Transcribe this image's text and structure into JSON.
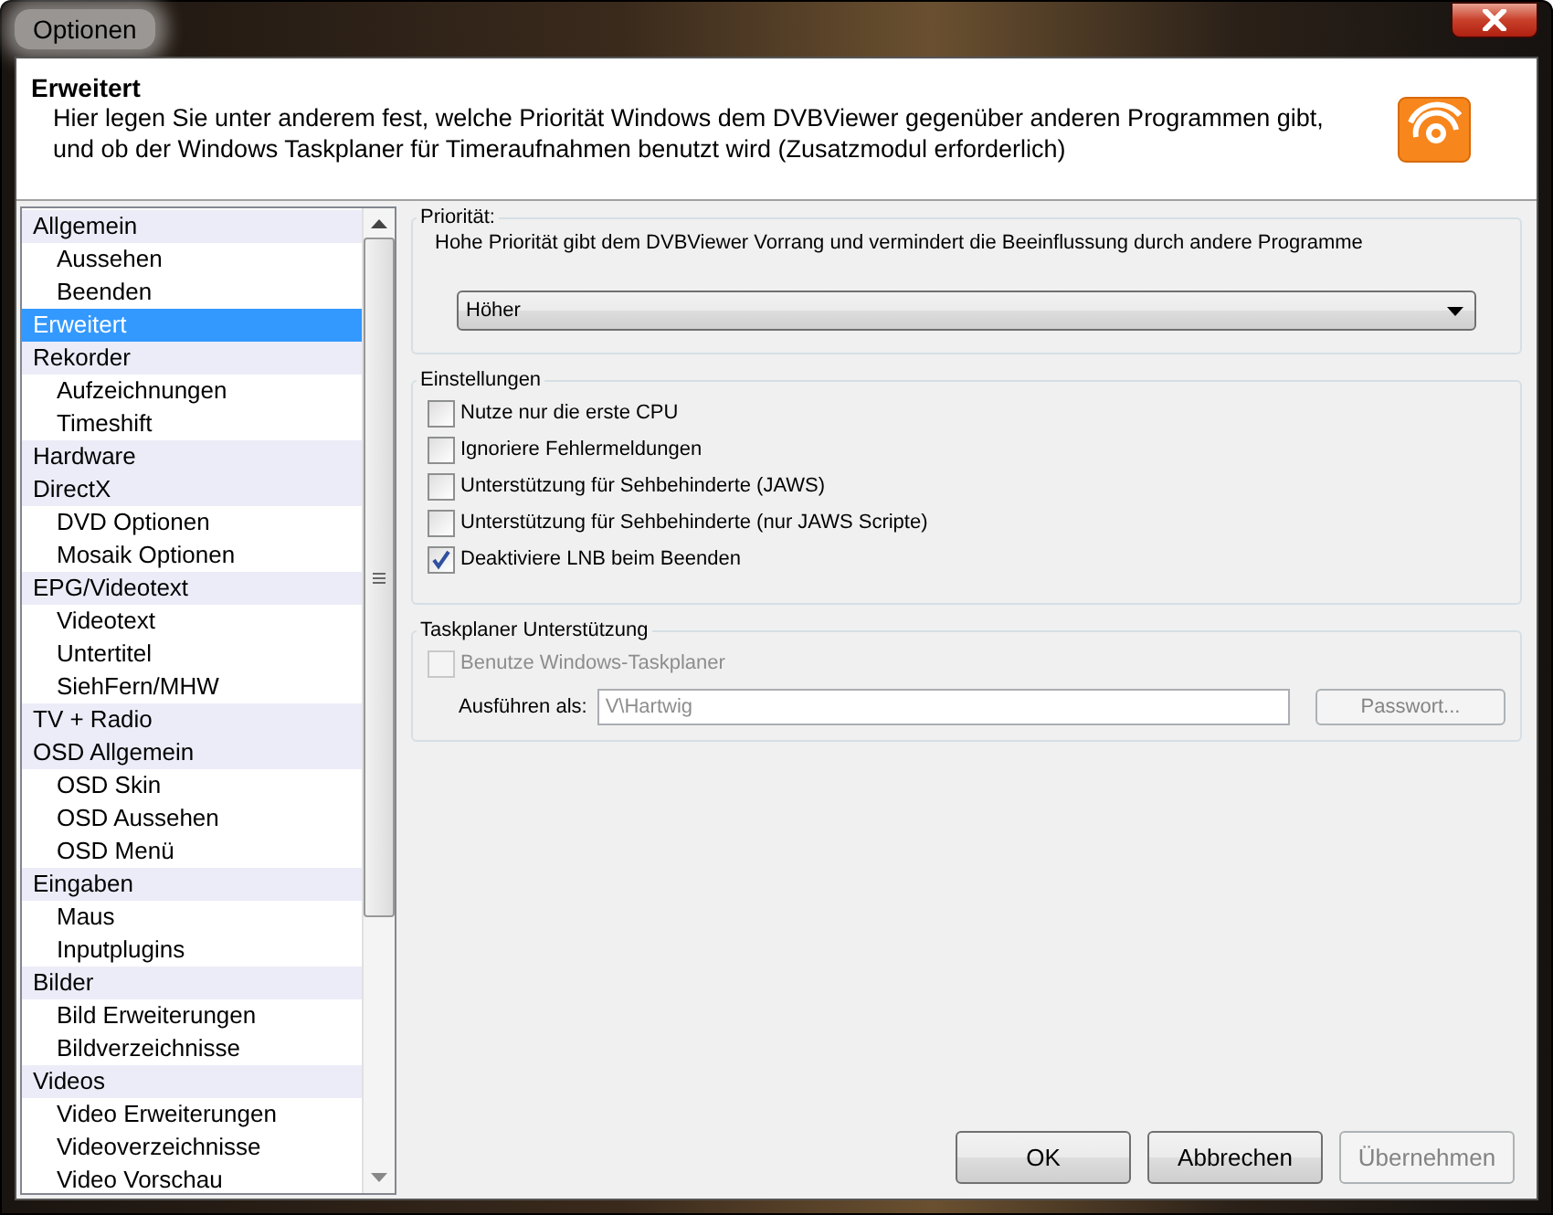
{
  "window": {
    "title": "Optionen"
  },
  "header": {
    "title": "Erweitert",
    "description": "Hier legen Sie unter anderem fest, welche Priorität Windows dem DVBViewer gegenüber anderen Programmen gibt, und ob der Windows Taskplaner für Timeraufnahmen benutzt wird (Zusatzmodul erforderlich)"
  },
  "sidebar": {
    "items": [
      {
        "label": "Allgemein",
        "selected": false,
        "children": [
          {
            "label": "Aussehen",
            "selected": false
          },
          {
            "label": "Beenden",
            "selected": false
          }
        ]
      },
      {
        "label": "Erweitert",
        "selected": true
      },
      {
        "label": "Rekorder",
        "selected": false,
        "children": [
          {
            "label": "Aufzeichnungen",
            "selected": false
          },
          {
            "label": "Timeshift",
            "selected": false
          }
        ]
      },
      {
        "label": "Hardware",
        "selected": false
      },
      {
        "label": "DirectX",
        "selected": false,
        "children": [
          {
            "label": "DVD Optionen",
            "selected": false
          },
          {
            "label": "Mosaik Optionen",
            "selected": false
          }
        ]
      },
      {
        "label": "EPG/Videotext",
        "selected": false,
        "children": [
          {
            "label": "Videotext",
            "selected": false
          },
          {
            "label": "Untertitel",
            "selected": false
          },
          {
            "label": "SiehFern/MHW",
            "selected": false
          }
        ]
      },
      {
        "label": "TV + Radio",
        "selected": false
      },
      {
        "label": "OSD Allgemein",
        "selected": false,
        "children": [
          {
            "label": "OSD Skin",
            "selected": false
          },
          {
            "label": "OSD Aussehen",
            "selected": false
          },
          {
            "label": "OSD Menü",
            "selected": false
          }
        ]
      },
      {
        "label": "Eingaben",
        "selected": false,
        "children": [
          {
            "label": "Maus",
            "selected": false
          },
          {
            "label": "Inputplugins",
            "selected": false
          }
        ]
      },
      {
        "label": "Bilder",
        "selected": false,
        "children": [
          {
            "label": "Bild Erweiterungen",
            "selected": false
          },
          {
            "label": "Bildverzeichnisse",
            "selected": false
          }
        ]
      },
      {
        "label": "Videos",
        "selected": false,
        "children": [
          {
            "label": "Video Erweiterungen",
            "selected": false
          },
          {
            "label": "Videoverzeichnisse",
            "selected": false
          },
          {
            "label": "Video Vorschau",
            "selected": false
          }
        ]
      }
    ]
  },
  "priority": {
    "legend": "Priorität:",
    "description": "Hohe Priorität gibt dem DVBViewer Vorrang und vermindert die Beeinflussung durch andere Programme",
    "dropdown": {
      "value": "Höher"
    }
  },
  "settings": {
    "legend": "Einstellungen",
    "options": [
      {
        "label": "Nutze nur die erste CPU",
        "checked": false
      },
      {
        "label": "Ignoriere Fehlermeldungen",
        "checked": false
      },
      {
        "label": "Unterstützung für Sehbehinderte (JAWS)",
        "checked": false
      },
      {
        "label": "Unterstützung für Sehbehinderte (nur JAWS Scripte)",
        "checked": false
      },
      {
        "label": "Deaktiviere LNB beim Beenden",
        "checked": true
      }
    ]
  },
  "taskplaner": {
    "legend": "Taskplaner Unterstützung",
    "option": {
      "label": "Benutze Windows-Taskplaner",
      "checked": false,
      "disabled": true
    },
    "run_as": {
      "label": "Ausführen als:",
      "value": "V\\Hartwig",
      "disabled": true
    },
    "password_button": {
      "label": "Passwort...",
      "disabled": true
    }
  },
  "buttons": [
    {
      "label": "OK",
      "disabled": false
    },
    {
      "label": "Abbrechen",
      "disabled": false
    },
    {
      "label": "Übernehmen",
      "disabled": true
    }
  ]
}
